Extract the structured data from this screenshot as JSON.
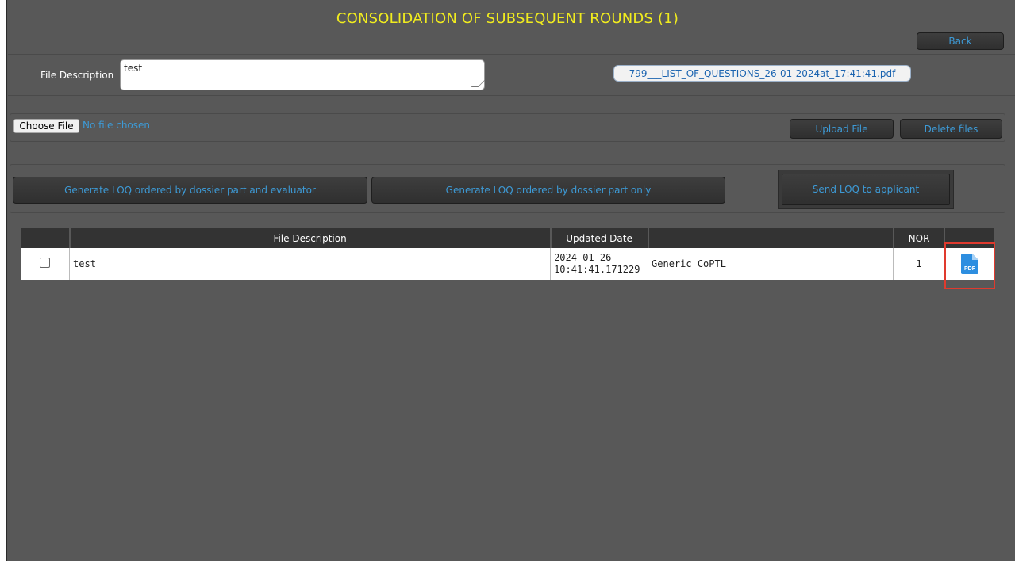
{
  "title": "CONSOLIDATION OF SUBSEQUENT ROUNDS (1)",
  "back_label": "Back",
  "file_description": {
    "label": "File Description",
    "value": "test"
  },
  "pdf_link": "799___LIST_OF_QUESTIONS_26-01-2024at_17:41:41.pdf",
  "file_input": {
    "button_label": "Choose File",
    "status": "No file chosen"
  },
  "upload_label": "Upload File",
  "delete_label": "Delete files",
  "generate_evaluator_label": "Generate LOQ ordered by dossier part and evaluator",
  "generate_part_label": "Generate LOQ ordered by dossier part only",
  "send_label": "Send LOQ to applicant",
  "table": {
    "headers": [
      "",
      "File Description",
      "Updated Date",
      "",
      "NOR",
      ""
    ],
    "rows": [
      {
        "description": "test",
        "date_line1": "2024-01-26",
        "date_line2": "10:41:41.171229",
        "type": "Generic CoPTL",
        "nor": "1",
        "icon": "pdf-icon"
      }
    ]
  },
  "colors": {
    "title": "#f1ec1e",
    "link": "#3d9ad6",
    "background": "#585858",
    "highlight": "#e03a2e"
  }
}
